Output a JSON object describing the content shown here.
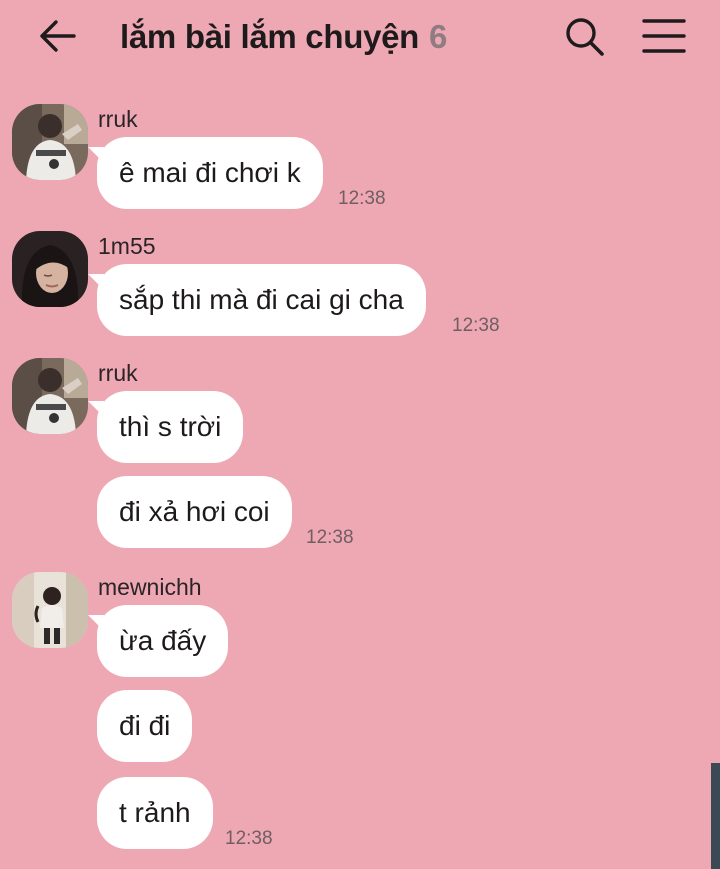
{
  "theme": {
    "background": "#eea8b3",
    "count_color": "#8f7c82",
    "icon_color": "#1f1b1c",
    "scrollbar": "#3b4954"
  },
  "header": {
    "back_icon": "arrow-left-icon",
    "title": "lắm bài lắm chuyện",
    "member_count": "6",
    "search_icon": "search-icon",
    "menu_icon": "hamburger-menu-icon"
  },
  "messages": [
    {
      "sender": "rruk",
      "avatar": "avatar-rruk",
      "texts": [
        "ê mai đi chơi k"
      ],
      "time": "12:38"
    },
    {
      "sender": "1m55",
      "avatar": "avatar-1m55",
      "texts": [
        "sắp thi mà đi cai gi cha"
      ],
      "time": "12:38"
    },
    {
      "sender": "rruk",
      "avatar": "avatar-rruk",
      "texts": [
        "thì s trời",
        "đi xả hơi coi"
      ],
      "time": "12:38"
    },
    {
      "sender": "mewnichh",
      "avatar": "avatar-mewnichh",
      "texts": [
        "ừa đấy",
        "đi đi",
        "t rảnh"
      ],
      "time": "12:38"
    }
  ]
}
